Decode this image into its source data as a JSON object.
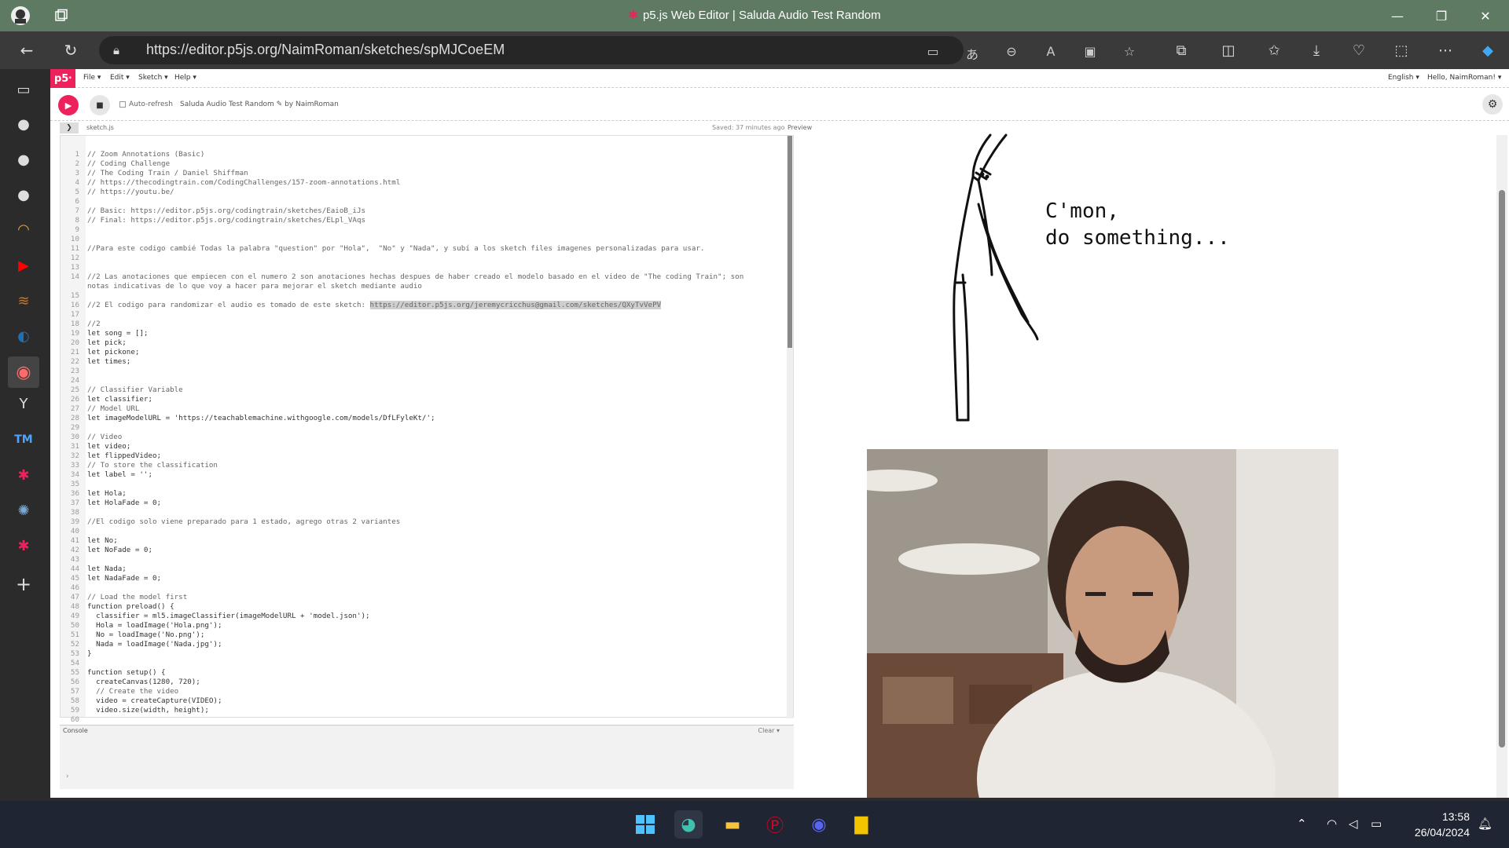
{
  "window": {
    "title": "p5.js Web Editor | Saluda Audio Test Random"
  },
  "browser": {
    "url": "https://editor.p5js.org/NaimRoman/sketches/spMJCoeEM"
  },
  "editor": {
    "menus": [
      "File ▾",
      "Edit ▾",
      "Sketch ▾",
      "Help ▾"
    ],
    "language": "English ▾",
    "greeting": "Hello, NaimRoman! ▾",
    "auto_refresh": "Auto-refresh",
    "sketch_name": "Saluda Audio Test Random",
    "author": "by NaimRoman",
    "filename": "sketch.js",
    "saved": "Saved: 37 minutes ago",
    "preview_label": "Preview",
    "console_title": "Console",
    "console_clear": "Clear"
  },
  "code": [
    {
      "n": "1",
      "t": "// Zoom Annotations (Basic)",
      "c": "cmt"
    },
    {
      "n": "2",
      "t": "// Coding Challenge",
      "c": "cmt"
    },
    {
      "n": "3",
      "t": "// The Coding Train / Daniel Shiffman",
      "c": "cmt"
    },
    {
      "n": "4",
      "t": "// https://thecodingtrain.com/CodingChallenges/157-zoom-annotations.html",
      "c": "cmt"
    },
    {
      "n": "5",
      "t": "// https://youtu.be/",
      "c": "cmt"
    },
    {
      "n": "6",
      "t": "",
      "c": ""
    },
    {
      "n": "7",
      "t": "// Basic: https://editor.p5js.org/codingtrain/sketches/EaioB_iJs",
      "c": "cmt"
    },
    {
      "n": "8",
      "t": "// Final: https://editor.p5js.org/codingtrain/sketches/ELpl_VAqs",
      "c": "cmt"
    },
    {
      "n": "9",
      "t": "",
      "c": ""
    },
    {
      "n": "10",
      "t": "",
      "c": ""
    },
    {
      "n": "11",
      "t": "//Para este codigo cambié Todas la palabra \"question\" por \"Hola\",  \"No\" y \"Nada\", y subí a los sketch files imagenes personalizadas para usar.",
      "c": "cmt"
    },
    {
      "n": "12",
      "t": "",
      "c": ""
    },
    {
      "n": "13",
      "t": "",
      "c": ""
    },
    {
      "n": "14",
      "t": "//2 Las anotaciones que empiecen con el numero 2 son anotaciones hechas despues de haber creado el modelo basado en el video de \"The coding Train\"; son notas indicativas de lo que voy a hacer para mejorar el sketch mediante audio",
      "c": "cmt wrap"
    },
    {
      "n": "15",
      "t": "",
      "c": ""
    },
    {
      "n": "16",
      "t": "//2 El codigo para randomizar el audio es tomado de este sketch: ",
      "c": "cmt",
      "hl": "https://editor.p5js.org/jeremycricchus@gmail.com/sketches/QXyTvVePV"
    },
    {
      "n": "17",
      "t": "",
      "c": ""
    },
    {
      "n": "18",
      "t": "//2",
      "c": "cmt"
    },
    {
      "n": "19",
      "t": "let song = [];",
      "c": ""
    },
    {
      "n": "20",
      "t": "let pick;",
      "c": ""
    },
    {
      "n": "21",
      "t": "let pickone;",
      "c": ""
    },
    {
      "n": "22",
      "t": "let times;",
      "c": ""
    },
    {
      "n": "23",
      "t": "",
      "c": ""
    },
    {
      "n": "24",
      "t": "",
      "c": ""
    },
    {
      "n": "25",
      "t": "// Classifier Variable",
      "c": "cmt"
    },
    {
      "n": "26",
      "t": "let classifier;",
      "c": ""
    },
    {
      "n": "27",
      "t": "// Model URL",
      "c": "cmt"
    },
    {
      "n": "28",
      "t": "let imageModelURL = 'https://teachablemachine.withgoogle.com/models/DfLFyleKt/';",
      "c": ""
    },
    {
      "n": "29",
      "t": "",
      "c": ""
    },
    {
      "n": "30",
      "t": "// Video",
      "c": "cmt"
    },
    {
      "n": "31",
      "t": "let video;",
      "c": ""
    },
    {
      "n": "32",
      "t": "let flippedVideo;",
      "c": ""
    },
    {
      "n": "33",
      "t": "// To store the classification",
      "c": "cmt"
    },
    {
      "n": "34",
      "t": "let label = '';",
      "c": ""
    },
    {
      "n": "35",
      "t": "",
      "c": ""
    },
    {
      "n": "36",
      "t": "let Hola;",
      "c": ""
    },
    {
      "n": "37",
      "t": "let HolaFade = 0;",
      "c": ""
    },
    {
      "n": "38",
      "t": "",
      "c": ""
    },
    {
      "n": "39",
      "t": "//El codigo solo viene preparado para 1 estado, agrego otras 2 variantes",
      "c": "cmt"
    },
    {
      "n": "40",
      "t": "",
      "c": ""
    },
    {
      "n": "41",
      "t": "let No;",
      "c": ""
    },
    {
      "n": "42",
      "t": "let NoFade = 0;",
      "c": ""
    },
    {
      "n": "43",
      "t": "",
      "c": ""
    },
    {
      "n": "44",
      "t": "let Nada;",
      "c": ""
    },
    {
      "n": "45",
      "t": "let NadaFade = 0;",
      "c": ""
    },
    {
      "n": "46",
      "t": "",
      "c": ""
    },
    {
      "n": "47",
      "t": "// Load the model first",
      "c": "cmt"
    },
    {
      "n": "48",
      "t": "function preload() {",
      "c": ""
    },
    {
      "n": "49",
      "t": "  classifier = ml5.imageClassifier(imageModelURL + 'model.json');",
      "c": ""
    },
    {
      "n": "50",
      "t": "  Hola = loadImage('Hola.png');",
      "c": ""
    },
    {
      "n": "51",
      "t": "  No = loadImage('No.png');",
      "c": ""
    },
    {
      "n": "52",
      "t": "  Nada = loadImage('Nada.jpg');",
      "c": ""
    },
    {
      "n": "53",
      "t": "}",
      "c": ""
    },
    {
      "n": "54",
      "t": "",
      "c": ""
    },
    {
      "n": "55",
      "t": "function setup() {",
      "c": ""
    },
    {
      "n": "56",
      "t": "  createCanvas(1280, 720);",
      "c": ""
    },
    {
      "n": "57",
      "t": "  // Create the video",
      "c": "cmt"
    },
    {
      "n": "58",
      "t": "  video = createCapture(VIDEO);",
      "c": ""
    },
    {
      "n": "59",
      "t": "  video.size(width, height);",
      "c": ""
    },
    {
      "n": "60",
      "t": "",
      "c": ""
    }
  ],
  "preview": {
    "meme_line1": "C'mon,",
    "meme_line2": "do something..."
  },
  "taskbar": {
    "time": "13:58",
    "date": "26/04/2024"
  }
}
